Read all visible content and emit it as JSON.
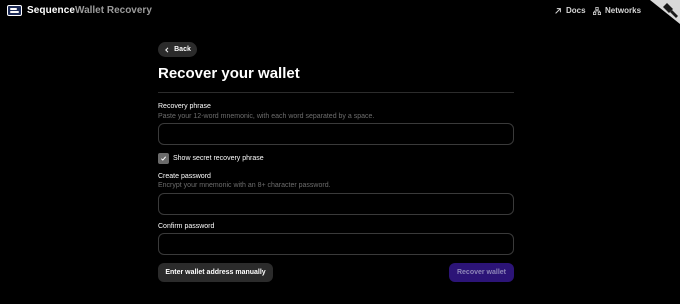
{
  "header": {
    "brand": "Sequence",
    "app_name": "Wallet Recovery",
    "links": [
      {
        "label": "Docs",
        "icon": "arrow-up-right-icon"
      },
      {
        "label": "Networks",
        "icon": "network-icon"
      }
    ],
    "corner_badge_icon": "diamond-badge-icon"
  },
  "main": {
    "back_label": "Back",
    "title": "Recover your wallet",
    "recovery_phrase": {
      "label": "Recovery phrase",
      "help": "Paste your 12-word mnemonic, with each word separated by a space.",
      "value": ""
    },
    "show_secret": {
      "label": "Show secret recovery phrase",
      "checked": true
    },
    "create_password": {
      "label": "Create password",
      "help": "Encrypt your mnemonic with an 8+ character password.",
      "value": ""
    },
    "confirm_password": {
      "label": "Confirm password",
      "value": ""
    },
    "manual_button_label": "Enter wallet address manually",
    "recover_button_label": "Recover wallet"
  },
  "colors": {
    "background": "#000000",
    "surface": "#2b2b2b",
    "accent": "#2c1477",
    "muted_text": "#6d6d6d"
  }
}
